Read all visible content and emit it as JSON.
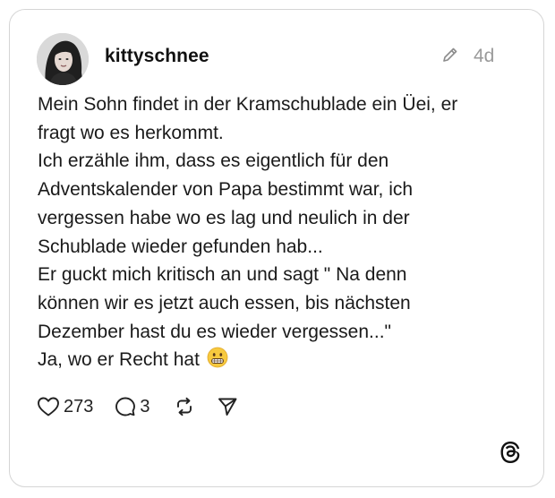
{
  "post": {
    "username": "kittyschnee",
    "timestamp": "4d",
    "lines": [
      "Mein Sohn findet in der Kramschublade ein Üei, er",
      "fragt wo es herkommt.",
      "Ich erzähle ihm, dass es eigentlich für den",
      "Adventskalender von Papa bestimmt war, ich",
      "vergessen habe wo es lag und neulich in der",
      "Schublade wieder gefunden hab...",
      "Er guckt mich kritisch an und sagt \" Na denn",
      "können wir es jetzt auch essen, bis nächsten",
      "Dezember hast du es wieder vergessen...\"",
      "Ja, wo er Recht hat"
    ],
    "emoji": "grimacing-face-emoji"
  },
  "actions": {
    "like_count": "273",
    "reply_count": "3"
  },
  "icons": {
    "edit": "pencil-icon",
    "like": "heart-icon",
    "reply": "speech-bubble-icon",
    "repost": "repost-icon",
    "share": "send-icon",
    "brand": "threads-logo-icon"
  },
  "colors": {
    "text": "#1a1a1a",
    "muted": "#9a9a9a",
    "border": "#d5d5d5"
  }
}
